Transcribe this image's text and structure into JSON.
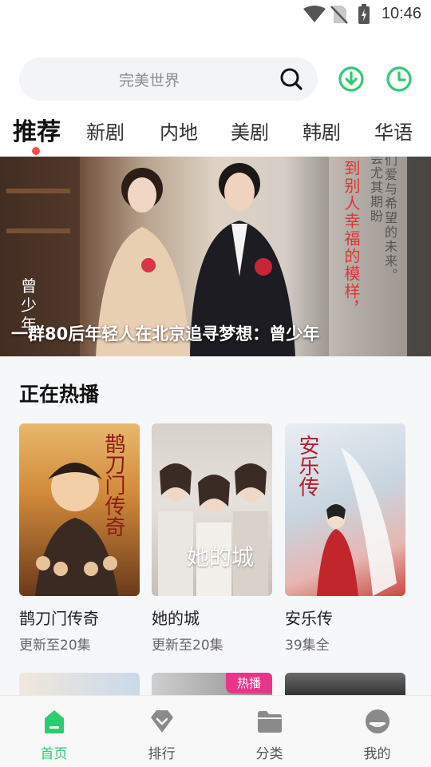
{
  "status_bar": {
    "time": "10:46"
  },
  "search": {
    "placeholder": "完美世界"
  },
  "tabs": [
    {
      "label": "推荐",
      "active": true
    },
    {
      "label": "新剧"
    },
    {
      "label": "内地"
    },
    {
      "label": "美剧"
    },
    {
      "label": "韩剧"
    },
    {
      "label": "华语"
    }
  ],
  "banner": {
    "caption": "一群80后年轻人在北京追寻梦想：曾少年",
    "side_text": "曾少年",
    "overlay_text_1": "到别人幸福的模样，",
    "overlay_text_2": "们爱与希望的未来。",
    "overlay_text_3": "会尤其期盼"
  },
  "section": {
    "title": "正在热播"
  },
  "cards": [
    {
      "name": "鹊刀门传奇",
      "sub": "更新至20集",
      "poster_text": "鹊刀门传奇"
    },
    {
      "name": "她的城",
      "sub": "更新至20集",
      "poster_text": "她的城"
    },
    {
      "name": "安乐传",
      "sub": "39集全",
      "poster_text": "安乐传"
    }
  ],
  "row2": {
    "badge": "热播"
  },
  "nav": [
    {
      "label": "首页",
      "icon": "home-icon",
      "active": true
    },
    {
      "label": "排行",
      "icon": "ranking-icon"
    },
    {
      "label": "分类",
      "icon": "category-folder-icon"
    },
    {
      "label": "我的",
      "icon": "profile-icon"
    }
  ],
  "colors": {
    "accent_green": "#2ecc71",
    "tab_dot_red": "#ff4b4b",
    "hot_badge": "#e8358a"
  }
}
